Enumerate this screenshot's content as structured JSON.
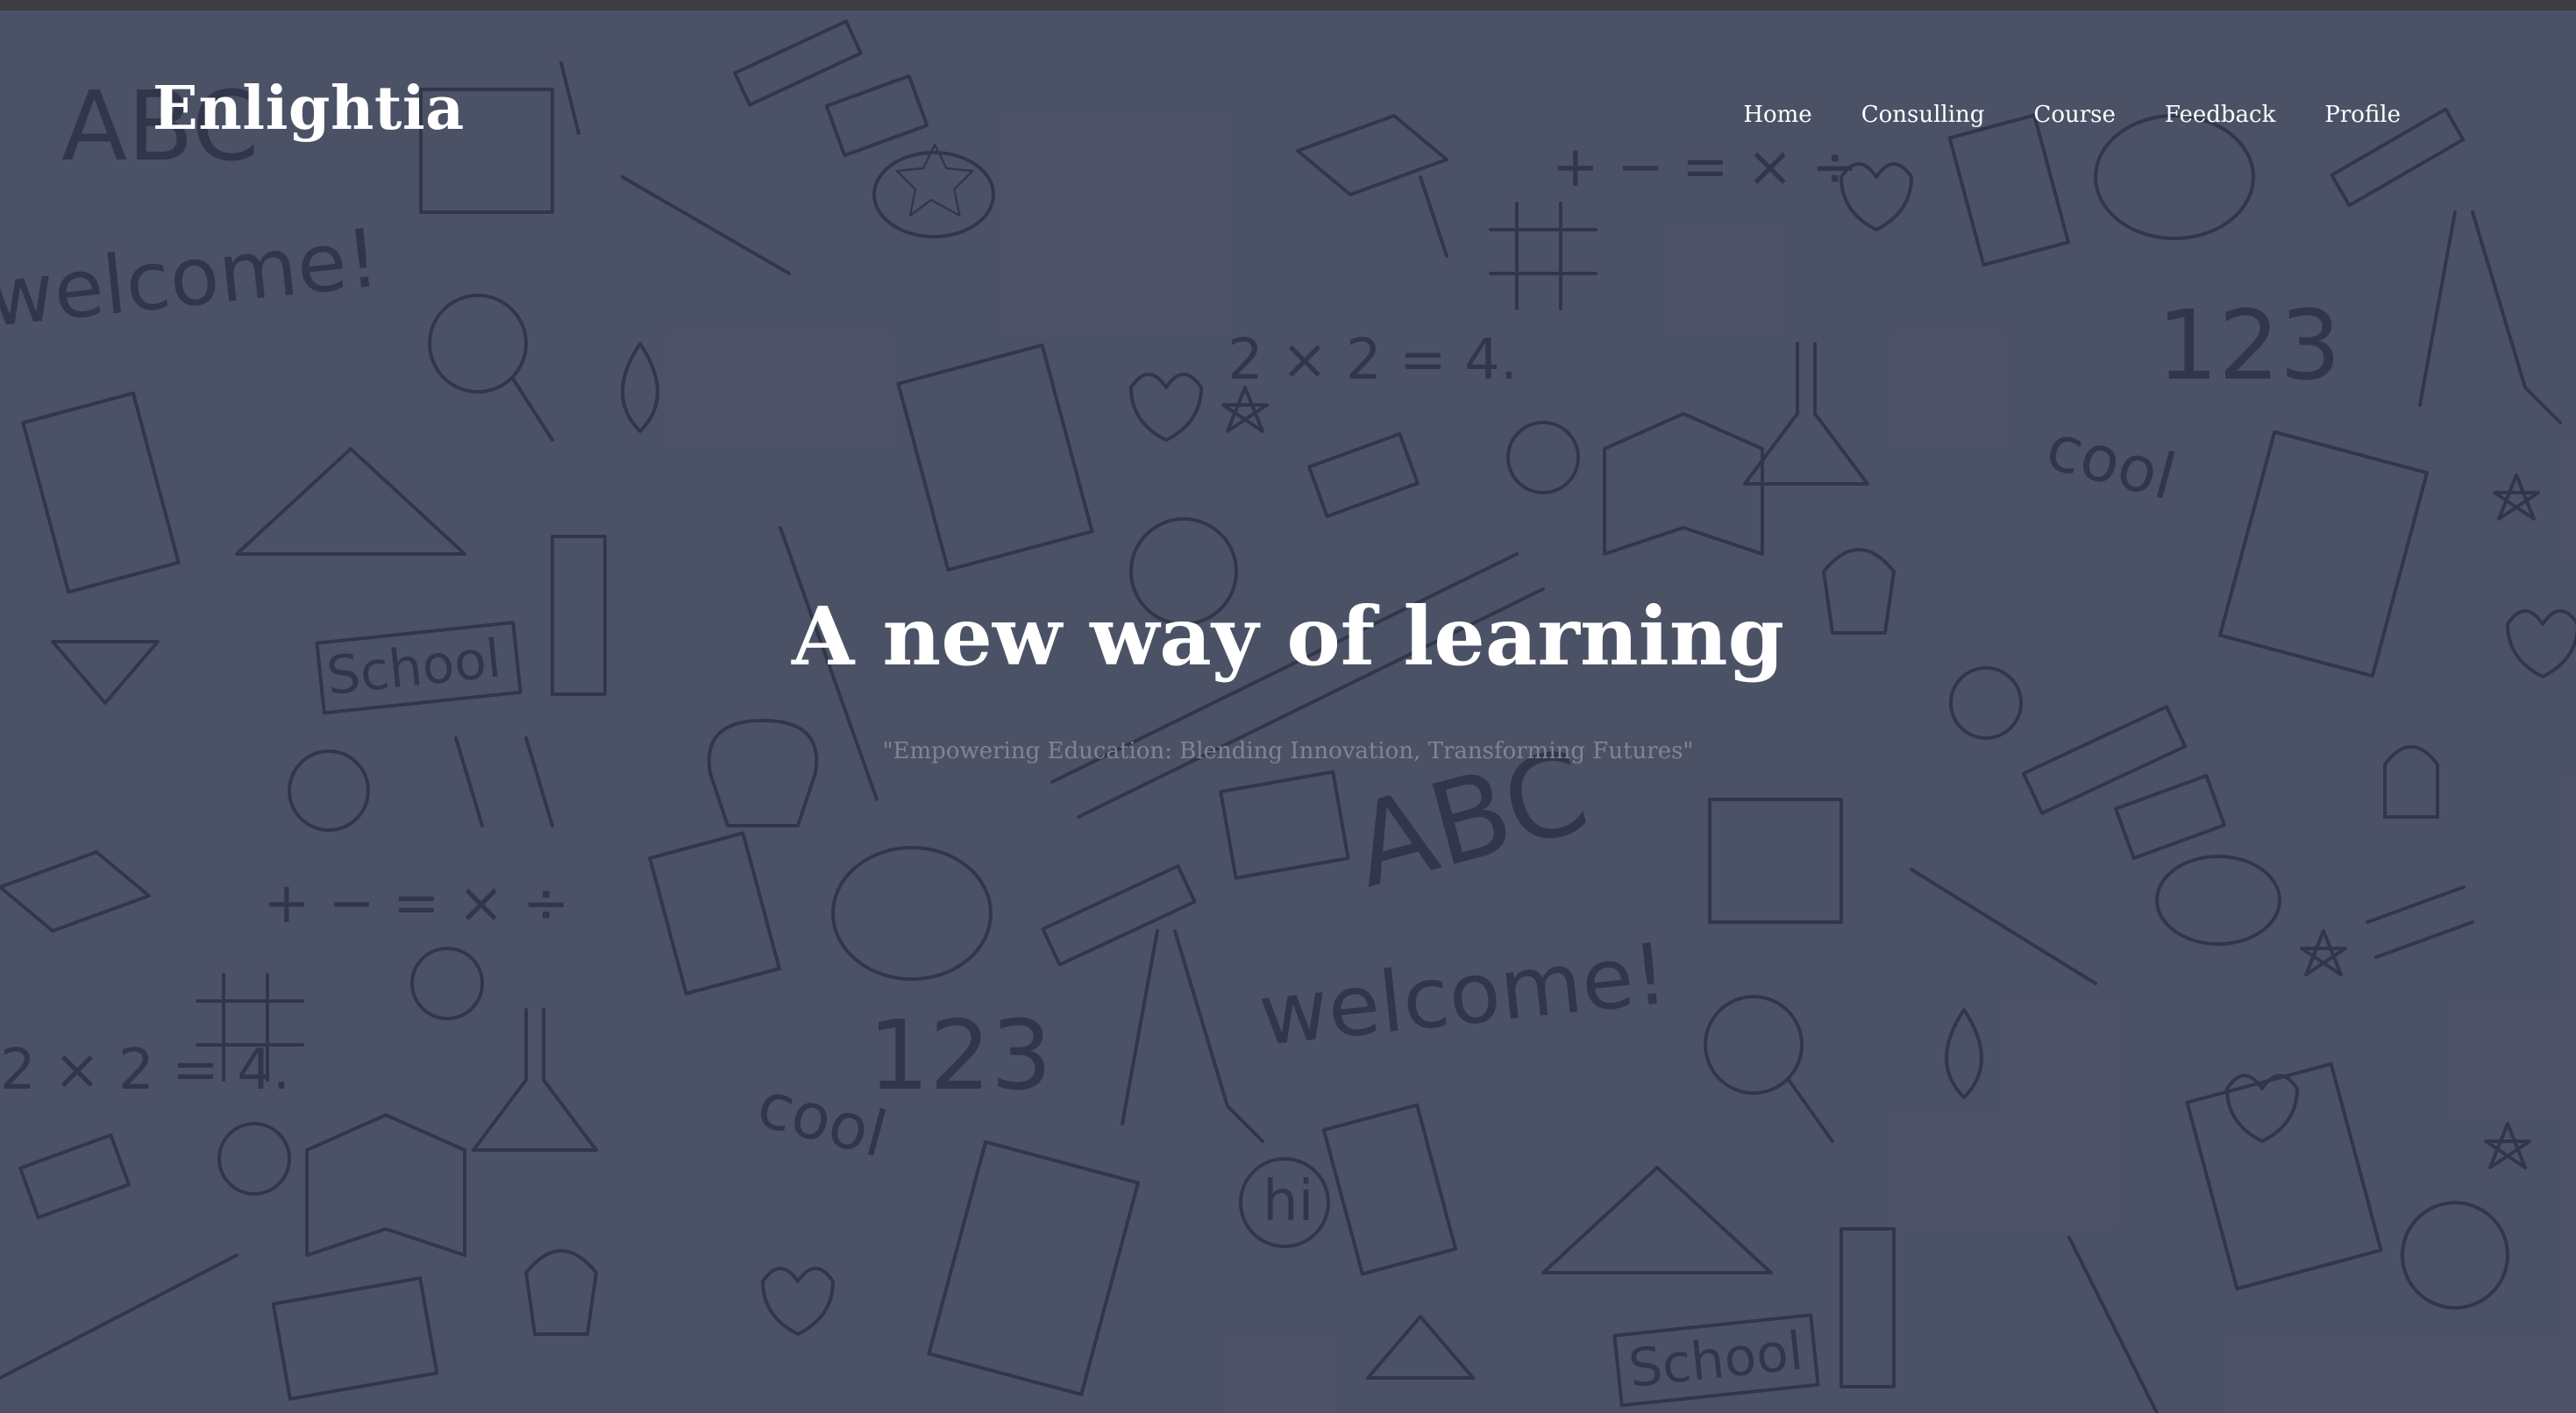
{
  "brand": {
    "name": "Enlightia"
  },
  "nav": {
    "items": [
      {
        "label": "Home"
      },
      {
        "label": "Consulling"
      },
      {
        "label": "Course"
      },
      {
        "label": "Feedback"
      },
      {
        "label": "Profile"
      }
    ]
  },
  "hero": {
    "title": "A new way of learning",
    "subtitle": "\"Empowering Education: Blending Innovation, Transforming Futures\"",
    "background": "school-doodle-pattern"
  },
  "doodle_text": {
    "welcome": "welcome!",
    "school": "School",
    "abc": "ABC",
    "cool": "cool",
    "num123": "123",
    "equation": "2 × 2 = 4.",
    "ops": "+ − = × ÷",
    "hi": "hi"
  },
  "colors": {
    "background": "#4b5063",
    "doodle_stroke": "#22263a",
    "text": "#ffffff",
    "subtitle": "#7f8497"
  }
}
